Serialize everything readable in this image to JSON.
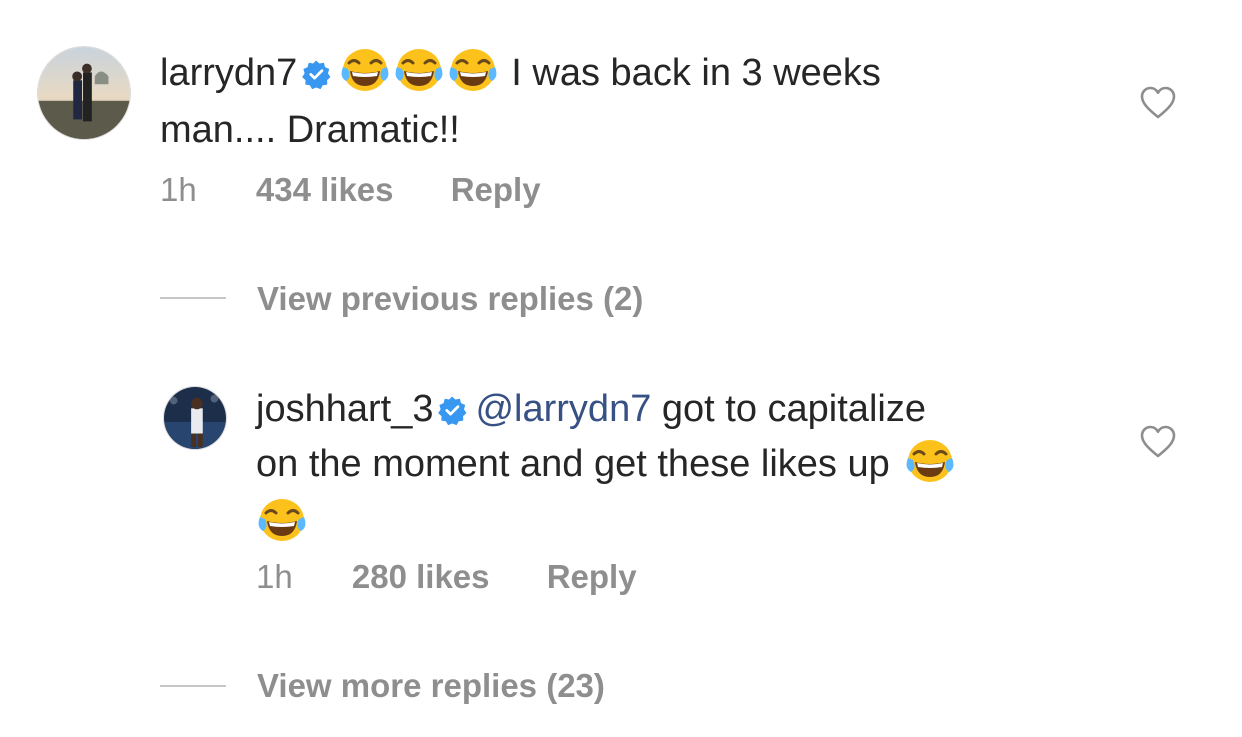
{
  "comments": [
    {
      "username": "larrydn7",
      "verified": true,
      "emoji_run": [
        "face-with-tears-of-joy",
        "face-with-tears-of-joy",
        "face-with-tears-of-joy"
      ],
      "text_line1": "I was back in 3 weeks",
      "text_line2": "man.... Dramatic!!",
      "time": "1h",
      "likes": "434 likes",
      "reply_label": "Reply"
    },
    {
      "username": "joshhart_3",
      "verified": true,
      "mention": "@larrydn7",
      "text_line1": "got to capitalize",
      "text_line2": "on the moment and get these likes up",
      "trailing_emoji": [
        "face-with-tears-of-joy",
        "face-with-tears-of-joy"
      ],
      "time": "1h",
      "likes": "280 likes",
      "reply_label": "Reply"
    }
  ],
  "threads": {
    "previous_replies": "View previous replies (2)",
    "more_replies": "View more replies (23)"
  },
  "colors": {
    "text": "#262626",
    "secondary": "#8e8e8e",
    "mention": "#385185",
    "verified": "#3897f0"
  }
}
